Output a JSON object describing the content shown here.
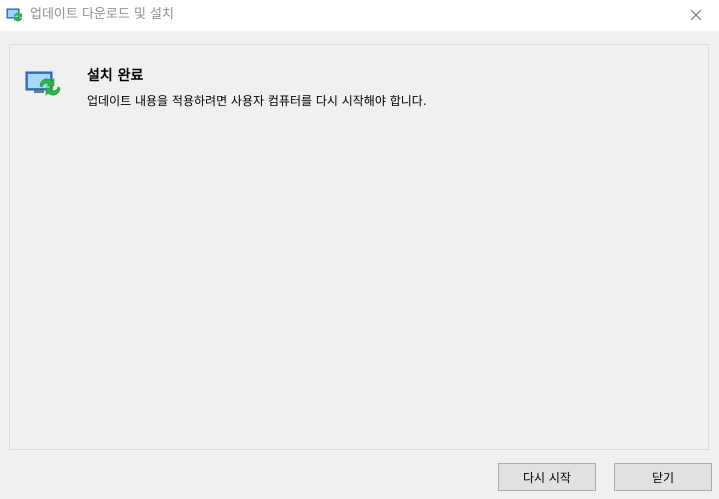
{
  "window": {
    "title": "업데이트 다운로드 및 설치",
    "title_icon": "windows-update-icon",
    "close_icon": "close-icon"
  },
  "content": {
    "icon": "windows-update-icon",
    "heading": "설치 완료",
    "message": "업데이트 내용을 적용하려면 사용자 컴퓨터를 다시 시작해야 합니다."
  },
  "buttons": {
    "restart_label": "다시 시작",
    "close_label": "닫기"
  },
  "colors": {
    "accent_green": "#2fb24a",
    "monitor_blue": "#4a8fd6",
    "window_bg": "#f0f0f0",
    "titlebar_bg": "#ffffff"
  }
}
